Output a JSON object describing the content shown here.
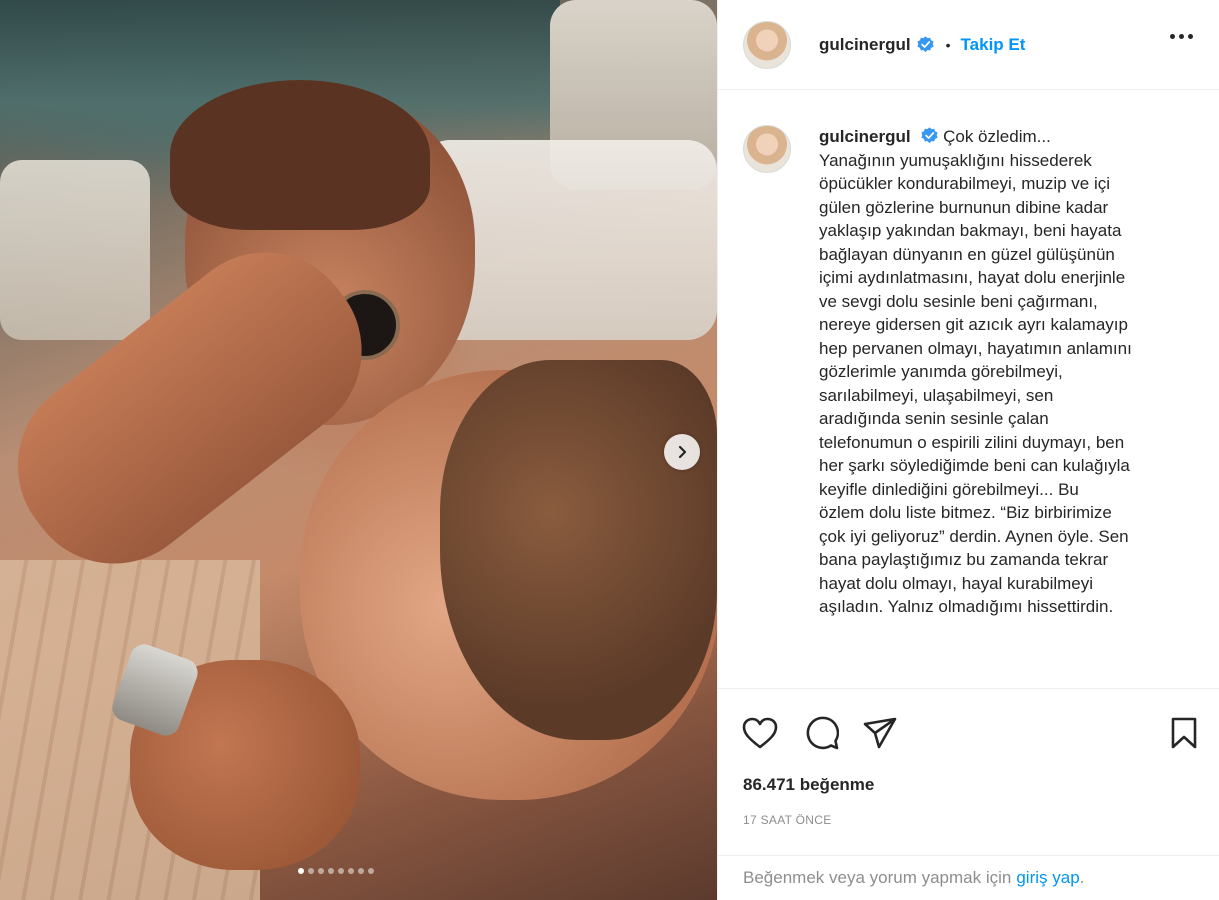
{
  "post": {
    "username": "gulcinergul",
    "follow_label": "Takip Et",
    "separator": "•",
    "caption_lines": [
      "Çok özledim...",
      "Yanağının yumuşaklığını hissederek",
      "öpücükler kondurabilmeyi, muzip ve içi",
      "gülen gözlerine burnunun dibine kadar",
      "yaklaşıp yakından bakmayı, beni hayata",
      "bağlayan dünyanın en güzel gülüşünün",
      "içimi aydınlatmasını, hayat dolu enerjinle",
      "ve sevgi dolu sesinle beni çağırmanı,",
      "nereye gidersen git azıcık ayrı kalamayıp",
      "hep pervanen olmayı, hayatımın anlamını",
      "gözlerimle yanımda görebilmeyi,",
      "sarılabilmeyi, ulaşabilmeyi, sen",
      "aradığında senin sesinle çalan",
      "telefonumun o espirili zilini duymayı, ben",
      "her şarkı söylediğimde beni can kulağıyla",
      "keyifle dinlediğini görebilmeyi... Bu",
      "özlem dolu liste bitmez. “Biz birbirimize",
      "çok iyi geliyoruz” derdin. Aynen öyle. Sen",
      "bana paylaştığımız bu zamanda tekrar",
      "hayat dolu olmayı, hayal kurabilmeyi",
      "aşıladın. Yalnız olmadığımı hissettirdin."
    ],
    "likes": "86.471 beğenme",
    "time_ago": "17 SAAT ÖNCE",
    "carousel_count": 8,
    "carousel_active": 1
  },
  "footer": {
    "prompt": "Beğenmek veya yorum yapmak için",
    "login_link": "giriş yap",
    "suffix": "."
  },
  "icons": {
    "like": "heart-icon",
    "comment": "comment-icon",
    "share": "share-icon",
    "save": "bookmark-icon",
    "more": "more-options-icon",
    "next": "chevron-right-icon",
    "verified": "verified-badge-icon"
  },
  "colors": {
    "link_blue": "#0095f6",
    "verified_blue": "#3897f0",
    "text": "#262626",
    "muted": "#8e8e8e"
  }
}
